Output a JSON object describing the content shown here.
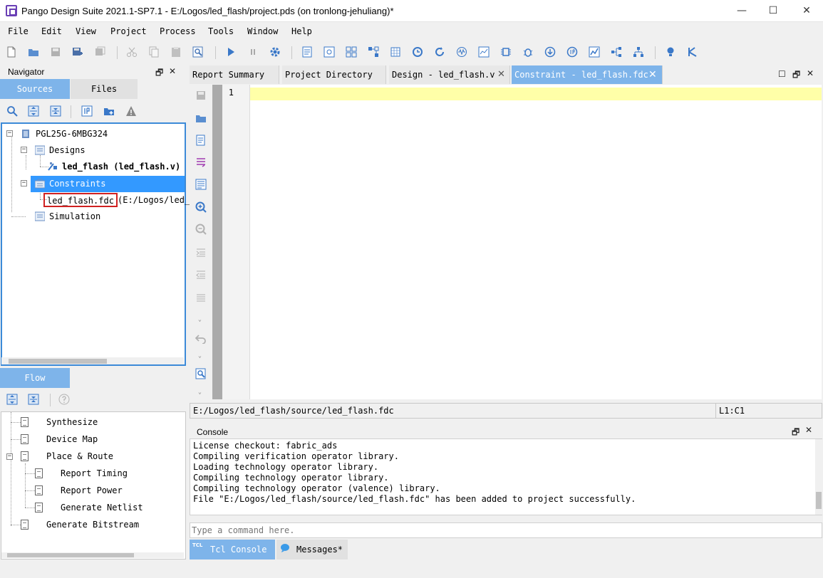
{
  "window": {
    "title": "Pango Design Suite 2021.1-SP7.1 - E:/Logos/led_flash/project.pds (on tronlong-jehuliang)*",
    "minimize": "—",
    "maximize": "☐",
    "close": "✕"
  },
  "menu": [
    "File",
    "Edit",
    "View",
    "Project",
    "Process",
    "Tools",
    "Window",
    "Help"
  ],
  "navigator": {
    "title": "Navigator",
    "tabs": {
      "sources": "Sources",
      "files": "Files"
    },
    "tree": {
      "device": "PGL25G-6MBG324",
      "designs": "Designs",
      "design_file": "led_flash (led_flash.v)",
      "constraints": "Constraints",
      "constraint_file": "led_flash.fdc",
      "constraint_path": "(E:/Logos/led_",
      "simulation": "Simulation"
    }
  },
  "flow": {
    "tab": "Flow",
    "items": {
      "synthesize": "Synthesize",
      "device_map": "Device Map",
      "place_route": "Place & Route",
      "report_timing": "Report Timing",
      "report_power": "Report Power",
      "generate_netlist": "Generate Netlist",
      "generate_bitstream": "Generate Bitstream"
    }
  },
  "editor": {
    "tabs": {
      "report_summary": "Report Summary",
      "project_directory": "Project Directory",
      "design": "Design - led_flash.v",
      "constraint": "Constraint - led_flash.fdc"
    },
    "line_number": "1",
    "status_path": "E:/Logos/led_flash/source/led_flash.fdc",
    "cursor_pos": "L1:C1"
  },
  "console": {
    "title": "Console",
    "lines": [
      "License checkout: fabric_ads",
      "Compiling verification operator library.",
      "Loading technology operator library.",
      "Compiling technology operator library.",
      "Compiling technology operator (valence) library.",
      "File \"E:/Logos/led_flash/source/led_flash.fdc\" has been added to project successfully."
    ],
    "command_placeholder": "Type a command here.",
    "tabs": {
      "tcl_badge": "TCL",
      "tcl": "Tcl Console",
      "messages": "Messages*"
    }
  },
  "colors": {
    "accent_tab": "#7eb4ea",
    "selection": "#3399ff",
    "highlight_box": "#d02020",
    "current_line": "#ffffa8"
  }
}
